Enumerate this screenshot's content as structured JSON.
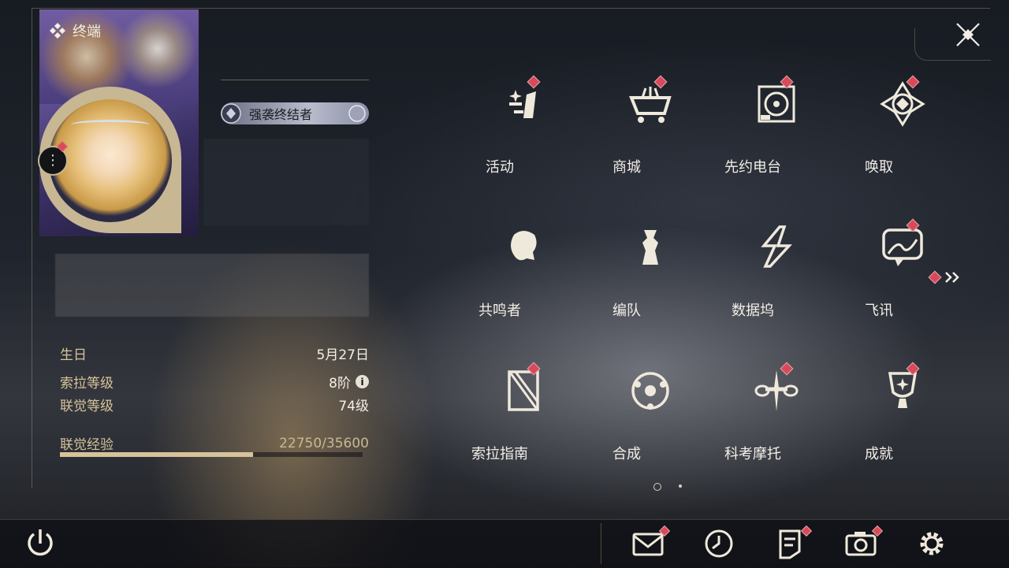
{
  "header": {
    "title": "终端"
  },
  "profile": {
    "title_badge": "强袭终结者",
    "stats": [
      {
        "label": "生日",
        "value": "5月27日"
      },
      {
        "label": "索拉等级",
        "value": "8阶"
      },
      {
        "label": "联觉等级",
        "value": "74级"
      }
    ],
    "exp": {
      "label": "联觉经验",
      "value": "22750/35600",
      "current": 22750,
      "max": 35600
    }
  },
  "grid": [
    {
      "label": "活动",
      "icon": "activity-icon",
      "badge": true
    },
    {
      "label": "商城",
      "icon": "shop-icon",
      "badge": true
    },
    {
      "label": "先约电台",
      "icon": "radio-icon",
      "badge": true
    },
    {
      "label": "唤取",
      "icon": "summon-icon",
      "badge": true
    },
    {
      "label": "共鸣者",
      "icon": "resonator-icon",
      "badge": false
    },
    {
      "label": "编队",
      "icon": "team-icon",
      "badge": false
    },
    {
      "label": "数据坞",
      "icon": "data-bank-icon",
      "badge": false
    },
    {
      "label": "飞讯",
      "icon": "message-icon",
      "badge": true
    },
    {
      "label": "索拉指南",
      "icon": "guide-icon",
      "badge": true
    },
    {
      "label": "合成",
      "icon": "synthesis-icon",
      "badge": false
    },
    {
      "label": "科考摩托",
      "icon": "bike-icon",
      "badge": true
    },
    {
      "label": "成就",
      "icon": "trophy-icon",
      "badge": true
    }
  ],
  "pager": {
    "pages": 2,
    "current": 1
  },
  "bottom_bar": [
    {
      "icon": "power-icon",
      "badge": false
    },
    {
      "icon": "mail-icon",
      "badge": true
    },
    {
      "icon": "clock-icon",
      "badge": false
    },
    {
      "icon": "notice-icon",
      "badge": true
    },
    {
      "icon": "camera-icon",
      "badge": true
    },
    {
      "icon": "settings-icon",
      "badge": false
    }
  ],
  "colors": {
    "accent": "#d6c39a",
    "badge": "#d64a5a",
    "text": "#f2eee6"
  }
}
